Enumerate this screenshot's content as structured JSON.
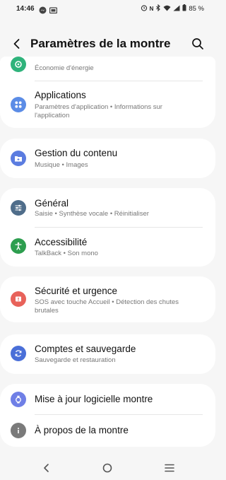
{
  "status_bar": {
    "time": "14:46",
    "battery": "85 %",
    "left_icons": [
      "messenger-icon",
      "screen-cast-icon"
    ],
    "right_icons": [
      "alarm-icon",
      "nfc-icon",
      "bluetooth-icon",
      "wifi-icon",
      "signal-icon",
      "battery-icon"
    ]
  },
  "header": {
    "title": "Paramètres de la montre",
    "back_icon": "back-arrow-icon",
    "search_icon": "search-icon"
  },
  "items": [
    {
      "id": "economie",
      "title": "",
      "subtitle": "Économie d'énergie",
      "icon": "battery-saver-icon",
      "color": "#2fb37b"
    },
    {
      "id": "applications",
      "title": "Applications",
      "subtitle": "Paramètres d'application • Informations sur l'application",
      "icon": "apps-icon",
      "color": "#5b8ce6"
    },
    {
      "id": "gestion",
      "title": "Gestion du contenu",
      "subtitle": "Musique • Images",
      "icon": "folder-icon",
      "color": "#5b7ce0"
    },
    {
      "id": "general",
      "title": "Général",
      "subtitle": "Saisie • Synthèse vocale • Réinitialiser",
      "icon": "sliders-icon",
      "color": "#4f6d8a"
    },
    {
      "id": "accessibilite",
      "title": "Accessibilité",
      "subtitle": "TalkBack • Son mono",
      "icon": "accessibility-icon",
      "color": "#2d9e4f"
    },
    {
      "id": "securite",
      "title": "Sécurité et urgence",
      "subtitle": "SOS avec touche Accueil • Détection des chutes brutales",
      "icon": "emergency-icon",
      "color": "#e8625a"
    },
    {
      "id": "comptes",
      "title": "Comptes et sauvegarde",
      "subtitle": "Sauvegarde et restauration",
      "icon": "sync-icon",
      "color": "#4a6fd8"
    },
    {
      "id": "maj",
      "title": "Mise à jour logicielle montre",
      "subtitle": "",
      "icon": "software-update-icon",
      "color": "#6f7fe6"
    },
    {
      "id": "apropos",
      "title": "À propos de la montre",
      "subtitle": "",
      "icon": "info-icon",
      "color": "#7a7a7a"
    }
  ],
  "nav": {
    "back": "nav-back-icon",
    "home": "nav-home-icon",
    "recents": "nav-recents-icon"
  }
}
